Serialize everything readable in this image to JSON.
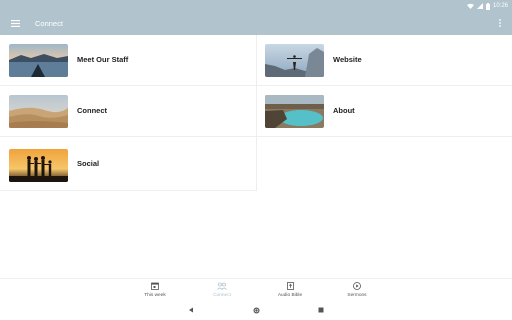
{
  "status_bar": {
    "time": "10:26",
    "icons": [
      "wifi-icon",
      "signal-icon",
      "battery-icon"
    ]
  },
  "app_bar": {
    "title": "Connect",
    "menu_icon": "hamburger-menu-icon",
    "overflow_icon": "more-vertical-icon"
  },
  "cards": [
    {
      "label": "Meet Our Staff",
      "image": "kayak-lake-photo"
    },
    {
      "label": "Website",
      "image": "person-on-rock-photo"
    },
    {
      "label": "Connect",
      "image": "sand-dunes-photo"
    },
    {
      "label": "About",
      "image": "crater-lake-photo"
    },
    {
      "label": "Social",
      "image": "silhouettes-sunset-photo"
    }
  ],
  "bottom_nav": {
    "items": [
      {
        "label": "This week",
        "icon": "calendar-icon",
        "active": false
      },
      {
        "label": "Connect",
        "icon": "people-icon",
        "active": true
      },
      {
        "label": "Audio Bible",
        "icon": "bible-icon",
        "active": false
      },
      {
        "label": "Sermons",
        "icon": "play-circle-icon",
        "active": false
      }
    ]
  },
  "system_nav": {
    "icons": [
      "back-icon",
      "home-icon",
      "recents-icon"
    ]
  },
  "colors": {
    "app_bar": "#b1c3cc",
    "active_nav": "#b1c3cc",
    "card_text": "#212121"
  }
}
